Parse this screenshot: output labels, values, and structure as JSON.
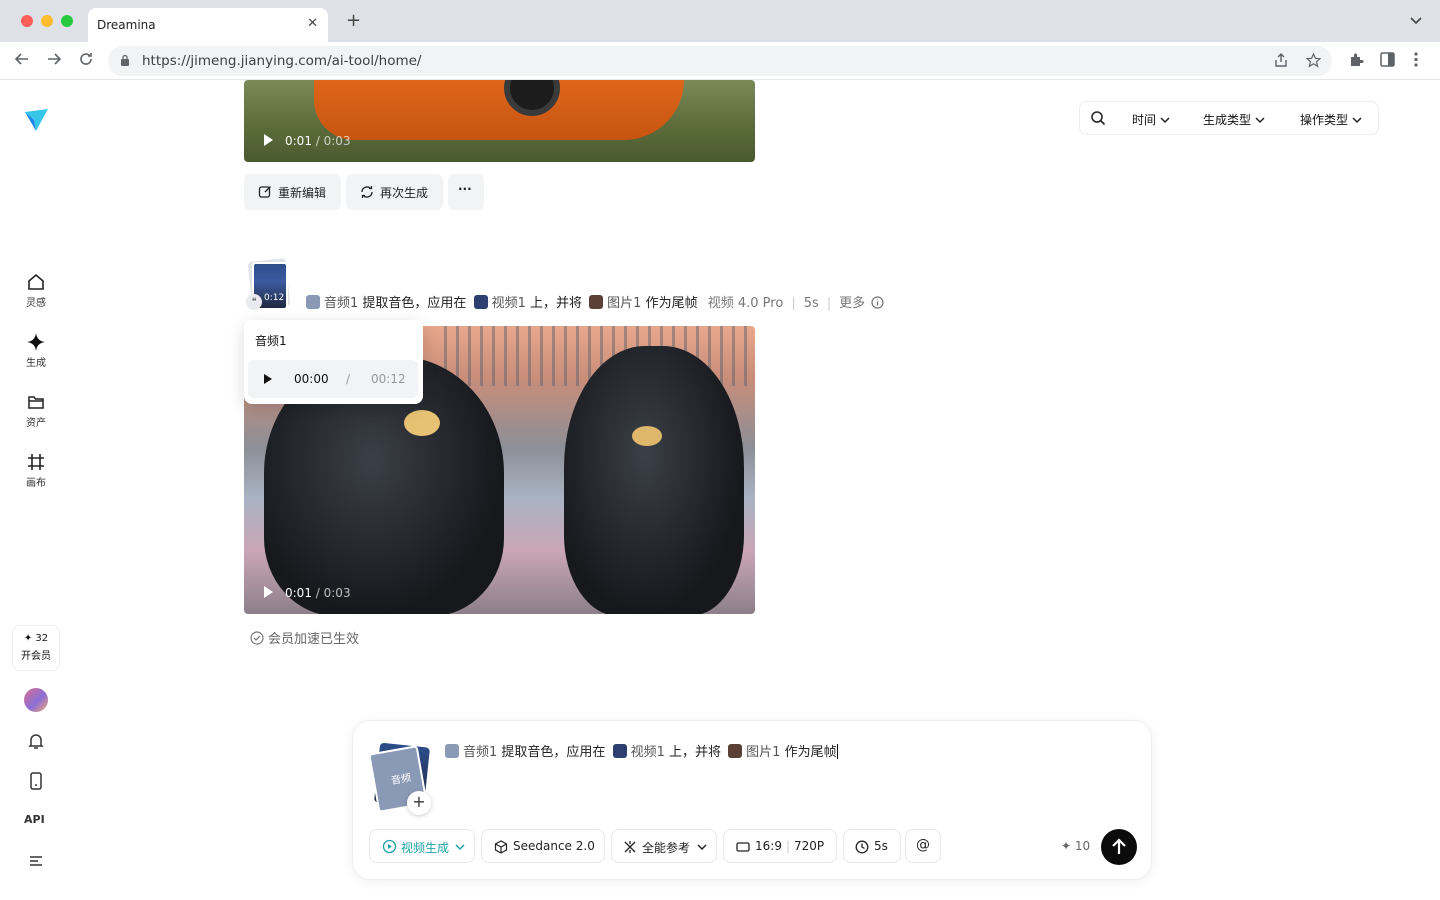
{
  "browser": {
    "tab_title": "Dreamina",
    "tab_close": "✕",
    "new_tab": "+",
    "url": "https://jimeng.jianying.com/ai-tool/home/"
  },
  "sidebar": {
    "items": [
      {
        "label": "灵感",
        "icon": "home-icon"
      },
      {
        "label": "生成",
        "icon": "sparkle-icon"
      },
      {
        "label": "资产",
        "icon": "folder-icon"
      },
      {
        "label": "画布",
        "icon": "canvas-icon"
      }
    ],
    "vip": {
      "credits": "✦ 32",
      "label": "开会员"
    },
    "api_label": "API"
  },
  "filters": {
    "time": "时间",
    "gen_type": "生成类型",
    "op_type": "操作类型"
  },
  "video1": {
    "time_current": "0:01",
    "time_total": "0:03",
    "actions": {
      "reedit": "重新编辑",
      "regenerate": "再次生成",
      "more": "···"
    }
  },
  "record2": {
    "thumb_duration": "0:12",
    "prompt": {
      "audio_ref": "音频1",
      "t1": "提取音色，应用在",
      "video_ref": "视频1",
      "t2": "上，并将",
      "image_ref": "图片1",
      "t3": "作为尾帧"
    },
    "model": "视频 4.0 Pro",
    "duration": "5s",
    "more": "更多"
  },
  "audio_popover": {
    "title": "音频1",
    "current": "00:00",
    "divider": "/",
    "total": "00:12"
  },
  "video2": {
    "time_current": "0:01",
    "time_total": "0:03"
  },
  "member_status": "会员加速已生效",
  "composer": {
    "thumb_label": "音频",
    "prompt": {
      "audio_ref": "音频1",
      "t1": "提取音色，应用在",
      "video_ref": "视频1",
      "t2": "上，并将",
      "image_ref": "图片1",
      "t3": "作为尾帧"
    },
    "mode": "视频生成",
    "model": "Seedance 2.0",
    "reference": "全能参考",
    "ratio": "16:9",
    "resolution": "720P",
    "duration": "5s",
    "mention": "@",
    "cost": "10"
  },
  "colors": {
    "accent": "#1fa3a8",
    "send_button": "#0b0b0b"
  }
}
